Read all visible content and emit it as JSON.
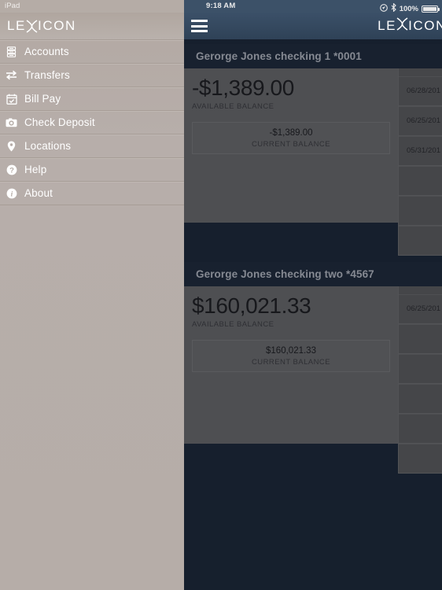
{
  "status_bar": {
    "device_label": "iPad",
    "wifi_icon": "wifi-icon",
    "time": "9:18 AM",
    "location_icon": "location-services-icon",
    "bluetooth_icon": "bluetooth-icon",
    "battery_percent": "100%",
    "battery_icon": "battery-full-icon"
  },
  "sidebar": {
    "brand": {
      "prefix": "LE",
      "x_glyph": "lexicon-x-icon",
      "suffix": "ICON"
    },
    "items": [
      {
        "label": "Accounts",
        "icon": "accounts-icon"
      },
      {
        "label": "Transfers",
        "icon": "transfers-icon"
      },
      {
        "label": "Bill Pay",
        "icon": "bill-pay-icon"
      },
      {
        "label": "Check Deposit",
        "icon": "check-deposit-camera-icon"
      },
      {
        "label": "Locations",
        "icon": "location-pin-icon"
      },
      {
        "label": "Help",
        "icon": "help-question-icon"
      },
      {
        "label": "About",
        "icon": "about-info-icon"
      }
    ]
  },
  "navbar": {
    "menu_icon": "hamburger-menu-icon",
    "brand": {
      "prefix": "LE",
      "x_glyph": "lexicon-x-icon",
      "suffix": "ICON"
    }
  },
  "accounts": [
    {
      "title": "Gerorge Jones checking 1 *0001",
      "available_amount": "-$1,389.00",
      "available_label": "AVAILABLE BALANCE",
      "current_amount": "-$1,389.00",
      "current_label": "CURRENT BALANCE",
      "transactions": [
        {
          "date": "06/28/201"
        },
        {
          "date": "06/25/201"
        },
        {
          "date": "05/31/201"
        },
        {
          "date": ""
        },
        {
          "date": ""
        },
        {
          "date": ""
        }
      ]
    },
    {
      "title": "Gerorge Jones checking two *4567",
      "available_amount": "$160,021.33",
      "available_label": "AVAILABLE BALANCE",
      "current_amount": "$160,021.33",
      "current_label": "CURRENT BALANCE",
      "transactions": [
        {
          "date": "06/25/201"
        },
        {
          "date": ""
        },
        {
          "date": ""
        },
        {
          "date": ""
        },
        {
          "date": ""
        },
        {
          "date": ""
        }
      ]
    }
  ],
  "colors": {
    "sidebar_bg": "#b6ada8",
    "navbar_bg": "#36495f",
    "app_bg": "#1b2635",
    "card_header_bg": "#1d2939",
    "card_body_bg": "#6a6a6a",
    "txn_bg": "#5e5e5e",
    "text_light": "#ffffff"
  }
}
